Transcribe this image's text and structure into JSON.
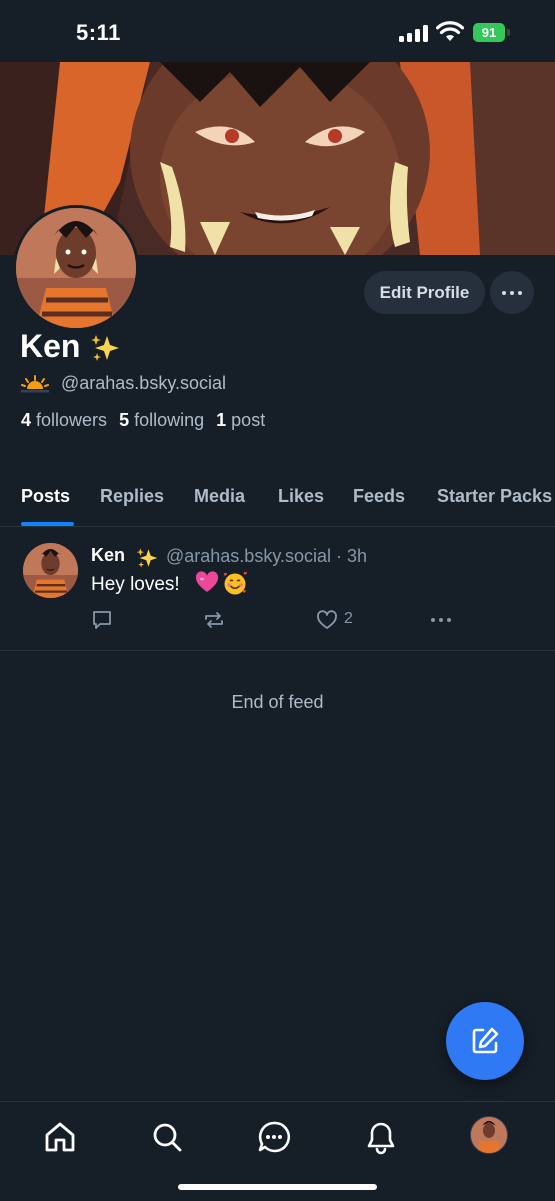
{
  "status_bar": {
    "time": "5:11",
    "battery": "91"
  },
  "profile": {
    "display_name": "Ken",
    "name_emoji": "sparkles-emoji",
    "handle": "@arahas.bsky.social",
    "handle_emoji": "sunrise-emoji",
    "followers_count": "4",
    "followers_label": "followers",
    "following_count": "5",
    "following_label": "following",
    "posts_count": "1",
    "posts_label": "post",
    "edit_button": "Edit Profile"
  },
  "tabs": [
    {
      "label": "Posts",
      "active": true
    },
    {
      "label": "Replies",
      "active": false
    },
    {
      "label": "Media",
      "active": false
    },
    {
      "label": "Likes",
      "active": false
    },
    {
      "label": "Feeds",
      "active": false
    },
    {
      "label": "Starter Packs",
      "active": false
    }
  ],
  "post": {
    "author": "Ken",
    "handle": "@arahas.bsky.social",
    "separator": "·",
    "time": "3h",
    "text": "Hey loves!",
    "emojis": [
      "pink-heart-emoji",
      "smiling-face-with-hearts-emoji"
    ],
    "like_count": "2"
  },
  "feed": {
    "end_text": "End of feed"
  },
  "colors": {
    "background": "#161e27",
    "accent": "#1083fe",
    "fab": "#2f79f5",
    "button_bg": "#26303c",
    "muted_text": "#aebbc9",
    "battery": "#34c759"
  },
  "nav": [
    "home-icon",
    "search-icon",
    "chat-icon",
    "bell-icon",
    "profile-avatar"
  ]
}
